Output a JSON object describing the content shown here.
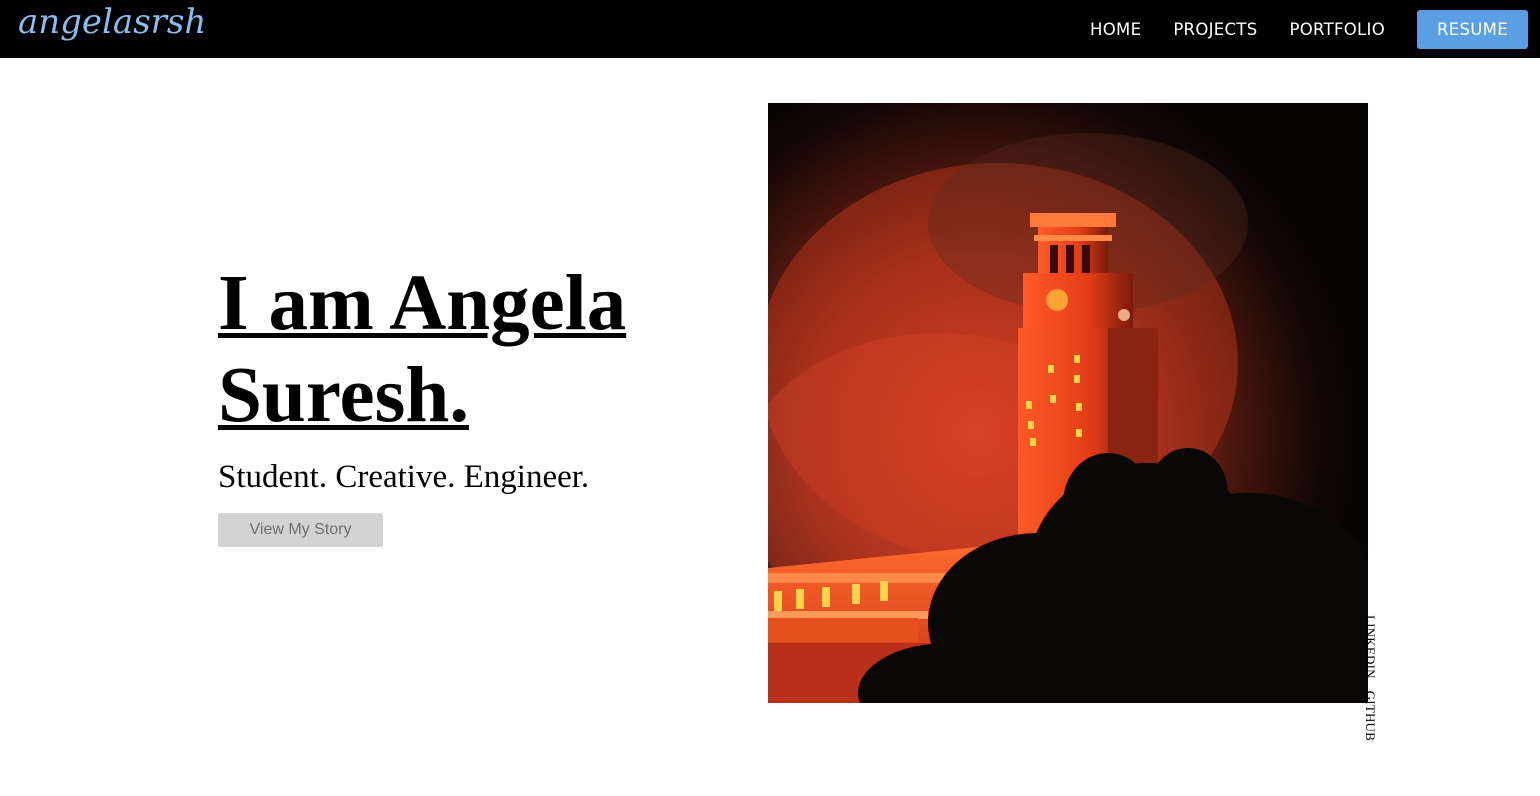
{
  "brand": {
    "logo_text": "angelasrsh",
    "logo_color": "#8cbcf0"
  },
  "nav": {
    "items": [
      {
        "label": "HOME"
      },
      {
        "label": "PROJECTS"
      },
      {
        "label": "PORTFOLIO"
      }
    ],
    "resume_label": "RESUME",
    "resume_color": "#5a9fe3"
  },
  "hero": {
    "title": "I am Angela Suresh.",
    "subtitle": "Student. Creative. Engineer.",
    "cta_label": "View My Story"
  },
  "photo": {
    "subject": "clock tower lit orange at night with smoke"
  },
  "social": {
    "linkedin": "LINKEDIN",
    "github": "GITHUB"
  }
}
